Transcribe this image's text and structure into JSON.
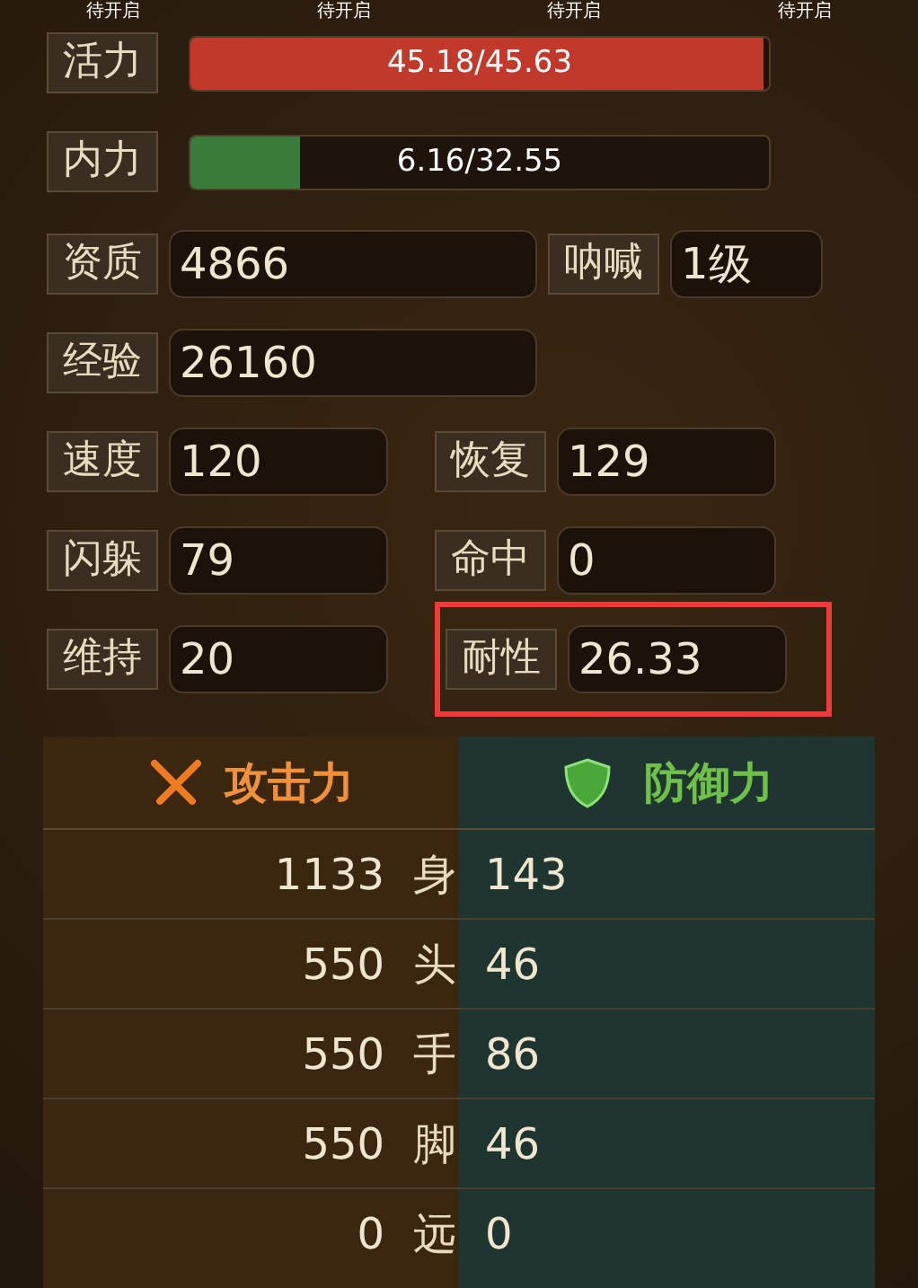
{
  "top_tabs": [
    "待开启",
    "待开启",
    "待开启",
    "待开启"
  ],
  "bars": [
    {
      "label": "活力",
      "reading": "45.18/45.63",
      "level": 0.99,
      "color": "#c0392b"
    },
    {
      "label": "内力",
      "reading": "6.16/32.55",
      "level": 0.19,
      "color": "#3a7d3a"
    }
  ],
  "stat_rows": [
    [
      {
        "kind": "wide",
        "label": "资质",
        "value": "4866",
        "highlighted": false
      },
      {
        "kind": "tail",
        "label": "呐喊",
        "value": "1级",
        "highlighted": false
      }
    ],
    [
      {
        "kind": "wide",
        "label": "经验",
        "value": "26160",
        "highlighted": false
      }
    ],
    [
      {
        "kind": "half",
        "label": "速度",
        "value": "120",
        "highlighted": false
      },
      {
        "kind": "half",
        "label": "恢复",
        "value": "129",
        "highlighted": false
      }
    ],
    [
      {
        "kind": "half",
        "label": "闪躲",
        "value": "79",
        "highlighted": false
      },
      {
        "kind": "half",
        "label": "命中",
        "value": "0",
        "highlighted": false
      }
    ],
    [
      {
        "kind": "half",
        "label": "维持",
        "value": "20",
        "highlighted": false
      },
      {
        "kind": "half",
        "label": "耐性",
        "value": "26.33",
        "highlighted": true
      }
    ]
  ],
  "combat": {
    "attack_title": "攻击力",
    "defense_title": "防御力",
    "rows": [
      {
        "attack": "1133",
        "part": "身",
        "defense": "143"
      },
      {
        "attack": "550",
        "part": "头",
        "defense": "46"
      },
      {
        "attack": "550",
        "part": "手",
        "defense": "86"
      },
      {
        "attack": "550",
        "part": "脚",
        "defense": "46"
      },
      {
        "attack": "0",
        "part": "远",
        "defense": "0"
      }
    ]
  }
}
